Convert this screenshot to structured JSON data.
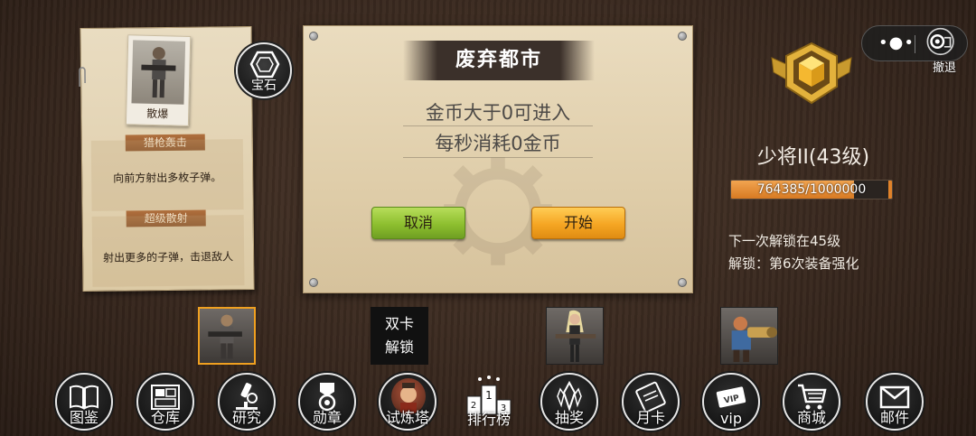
{
  "skill_card": {
    "hero_name": "散爆",
    "skill1_name": "猎枪轰击",
    "skill1_desc": "向前方射出多枚子弹。",
    "skill2_name": "超级散射",
    "skill2_desc": "射出更多的子弹，击退敌人"
  },
  "gem_button": {
    "label": "宝石",
    "icon": "gem-icon"
  },
  "dialog": {
    "title": "废弃都市",
    "line1": "金币大于0可进入",
    "line2": "每秒消耗0金币",
    "cancel_label": "取消",
    "start_label": "开始",
    "cancel_color": "#8dbf2f",
    "start_color": "#f5a623"
  },
  "top_controls": {
    "menu_icon": "more-dots-icon",
    "close_icon": "target-icon",
    "retreat_label": "撤退"
  },
  "rank": {
    "title": "少将II(43级)",
    "xp_text": "764385/1000000",
    "xp_current": 764385,
    "xp_max": 1000000,
    "next_unlock": "下一次解锁在45级",
    "unlock_reward": "解锁：第6次装备强化"
  },
  "characters": {
    "locked_line1": "双卡",
    "locked_line2": "解锁"
  },
  "nav": {
    "codex": "图鉴",
    "warehouse": "仓库",
    "research": "研究",
    "medal": "勋章",
    "trial_tower": "试炼塔",
    "leaderboard": "排行榜",
    "lottery": "抽奖",
    "monthly_card": "月卡",
    "vip": "vip",
    "shop": "商城",
    "mail": "邮件",
    "leaderboard_digits": [
      "2",
      "1",
      "3"
    ]
  }
}
